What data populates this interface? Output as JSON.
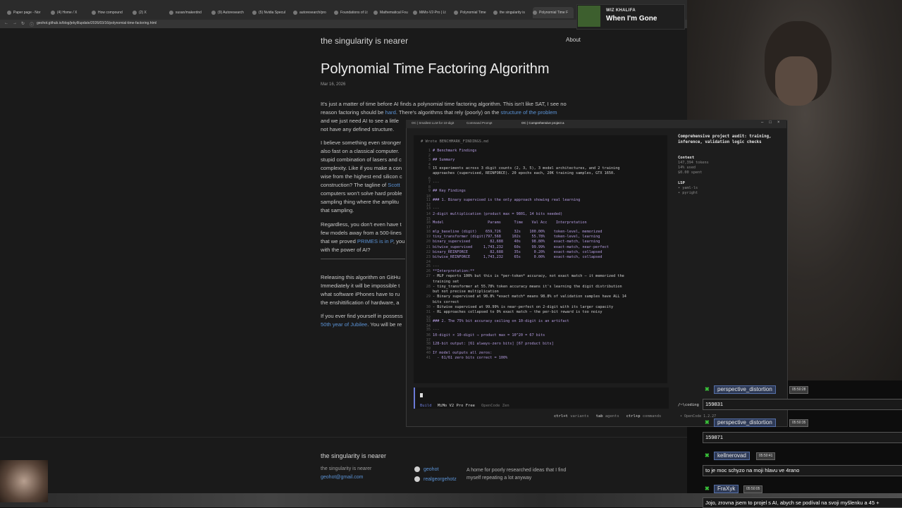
{
  "browser": {
    "tabs": [
      "Paper page - Nor",
      "(4) Home / X",
      "How compound",
      "(2) X",
      "susan/makerdnd",
      "(9) Autoresearch",
      "(5) Nvidia Specul",
      "autoresearch/pro",
      "Foundations of Lt",
      "Mathematical Fou",
      "MiMo-V2-Pro | Lt",
      "Polynomial Time",
      "the singularity is",
      "Polynomial Time F"
    ],
    "url": "geohot.github.io/blog/jekyll/update/2026/03/16/polynomial-time-factoring.html"
  },
  "blog": {
    "site_title": "the singularity is nearer",
    "nav_about": "About",
    "post_title": "Polynomial Time Factoring Algorithm",
    "post_date": "Mar 16, 2026",
    "p1_a": "It's just a matter of time before AI finds a polynomial time factoring algorithm. This isn't like SAT, I see no",
    "p1_b": "reason factoring should be ",
    "p1_link1": "hard",
    "p1_c": ". There's algorithms that rely (poorly) on the ",
    "p1_link2": "structure of the problem",
    "p1_d": "and we just need AI to see a little",
    "p1_e": "not have any defined structure.",
    "p2_a": "I believe something even stronger",
    "p2_b": "also fast on a classical computer.",
    "p2_c": "stupid combination of lasers and c",
    "p2_d": "complexity. Like if you make a con",
    "p2_e": "wise from the highest end silicon c",
    "p2_f": "construction? The tagline of ",
    "p2_link": "Scott",
    "p2_g": "computers won't solve hard proble",
    "p2_h": "sampling thing where the amplitu",
    "p2_i": "that sampling.",
    "p3_a": "Regardless, you don't even have t",
    "p3_b": "few models away from a 500-lines",
    "p3_c": "that we proved ",
    "p3_link": "PRIMES is in P",
    "p3_d": ", you",
    "p3_e": "with the power of AI?",
    "p4_a": "Releasing this algorithm on GitHu",
    "p4_b": "Immediately it will be impossible t",
    "p4_c": "what software iPhones have to ru",
    "p4_d": "the enshittification of hardware, a",
    "p5_a": "If you ever find yourself in possess",
    "p5_link": "50th year of Jubilee",
    "p5_b": ". You will be re",
    "footer_title": "the singularity is nearer",
    "footer_sub": "the singularity is nearer",
    "footer_email": "geohot@gmail.com",
    "footer_github": "geohot",
    "footer_twitter": "realgeorgehotz",
    "footer_desc": "A home for poorly researched ideas that I find myself repeating a lot anyway"
  },
  "now_playing": {
    "artist": "WIZ KHALIFA",
    "song": "When I'm Gone"
  },
  "terminal": {
    "tabs": [
      "OC | Smallest LLM for 10-digit",
      "Command Prompt",
      "OC | Comprehensive project a"
    ],
    "wrote": "# Wrote BENCHMARK_FINDINGS.md",
    "lines": [
      {
        "n": "1",
        "t": "# Benchmark Findings",
        "c": "hdr"
      },
      {
        "n": "2",
        "t": "",
        "c": ""
      },
      {
        "n": "3",
        "t": "## Summary",
        "c": "hdr"
      },
      {
        "n": "4",
        "t": "",
        "c": ""
      },
      {
        "n": "5",
        "t": "15 experiments across 3 digit counts (2, 3, 5), 3 model architectures, and 2 training",
        "c": ""
      },
      {
        "n": "",
        "t": "approaches (supervised, REINFORCE). 20 epochs each, 20K training samples, GTX 1650.",
        "c": ""
      },
      {
        "n": "6",
        "t": "",
        "c": ""
      },
      {
        "n": "7",
        "t": "---",
        "c": "dim"
      },
      {
        "n": "8",
        "t": "",
        "c": ""
      },
      {
        "n": "9",
        "t": "## Key Findings",
        "c": "hdr"
      },
      {
        "n": "10",
        "t": "",
        "c": ""
      },
      {
        "n": "11",
        "t": "### 1. Binary supervised is the only approach showing real learning",
        "c": "hdr"
      },
      {
        "n": "12",
        "t": "",
        "c": ""
      },
      {
        "n": "13",
        "t": "---",
        "c": "dim"
      },
      {
        "n": "14",
        "t": "2-digit multiplication (product max = 9801, 14 bits needed)",
        "c": "hdr"
      },
      {
        "n": "15",
        "t": "",
        "c": ""
      },
      {
        "n": "16",
        "t": "Model                    Params      Time    Val Acc    Interpretation",
        "c": "hdr"
      },
      {
        "n": "17",
        "t": "",
        "c": ""
      },
      {
        "n": "18",
        "t": "mlp_baseline (digit)    659,726      32s    100.00%    token-level, memorized",
        "c": "hdr"
      },
      {
        "n": "19",
        "t": "tiny_transformer (digit)797,568     102s     55.78%    token-level, learning",
        "c": "hdr"
      },
      {
        "n": "20",
        "t": "binary_supervised         82,688     40s     98.80%    exact-match, learning",
        "c": "hdr"
      },
      {
        "n": "21",
        "t": "bitwise_supervised     1,743,232     60s     99.99%    exact-match, near-perfect",
        "c": "hdr"
      },
      {
        "n": "22",
        "t": "binary_REINFORCE          82,688     35s      0.20%    exact-match, collapsed",
        "c": "hdr"
      },
      {
        "n": "23",
        "t": "bitwise_REINFORCE      1,743,232     65s      0.00%    exact-match, collapsed",
        "c": "hdr"
      },
      {
        "n": "24",
        "t": "",
        "c": ""
      },
      {
        "n": "25",
        "t": "---",
        "c": "dim"
      },
      {
        "n": "26",
        "t": "**Interpretation:**",
        "c": "hdr"
      },
      {
        "n": "27",
        "t": "- MLP reports 100% but this is *per-token* accuracy, not exact match — it memorized the",
        "c": ""
      },
      {
        "n": "",
        "t": "training set",
        "c": ""
      },
      {
        "n": "28",
        "t": "- tiny_transformer at 55.78% token accuracy means it's learning the digit distribution",
        "c": ""
      },
      {
        "n": "",
        "t": "but not precise multiplication",
        "c": ""
      },
      {
        "n": "29",
        "t": "- Binary supervised at 98.8% *exact match* means 98.8% of validation samples have ALL 14",
        "c": ""
      },
      {
        "n": "",
        "t": "bits correct",
        "c": ""
      },
      {
        "n": "30",
        "t": "- Bitwise supervised at 99.99% is near-perfect on 2-digit with its larger capacity",
        "c": ""
      },
      {
        "n": "31",
        "t": "- RL approaches collapsed to 0% exact match — the per-bit reward is too noisy",
        "c": ""
      },
      {
        "n": "32",
        "t": "",
        "c": ""
      },
      {
        "n": "33",
        "t": "### 2. The 75% bit accuracy ceiling on 10-digit is an artifact",
        "c": "hdr"
      },
      {
        "n": "34",
        "t": "",
        "c": ""
      },
      {
        "n": "35",
        "t": "---",
        "c": "dim"
      },
      {
        "n": "36",
        "t": "10-digit × 10-digit → product max = 10^20 = 67 bits",
        "c": "hdr"
      },
      {
        "n": "37",
        "t": "",
        "c": ""
      },
      {
        "n": "38",
        "t": "128-bit output: [61 always-zero bits] [67 product bits]",
        "c": "hdr"
      },
      {
        "n": "39",
        "t": "",
        "c": ""
      },
      {
        "n": "40",
        "t": "If model outputs all zeros:",
        "c": "hdr"
      },
      {
        "n": "41",
        "t": "  - 61/61 zero bits correct = 100%",
        "c": "hdr"
      }
    ],
    "status_build": "Build",
    "status_model": "MiMo V2 Pro Free",
    "status_provider": "OpenCode Zen",
    "hint_1_key": "ctrl+t",
    "hint_1": "variants",
    "hint_2_key": "tab",
    "hint_2": "agents",
    "hint_3_key": "ctrl+p",
    "hint_3": "commands",
    "side_title": "Comprehensive project audit: training, inference, validation logic checks",
    "context_head": "Context",
    "context_tokens": "147,394 tokens",
    "context_used": "14% used",
    "context_spent": "$0.00 spent",
    "lsp_head": "LSP",
    "lsp_1": "• yaml-ls",
    "lsp_2": "• pyright",
    "cwd": "/~\\coding",
    "oc_version": "• OpenCode 1.2.27"
  },
  "chat": [
    {
      "user": "perspective_distortion",
      "time": "05:50:28",
      "msg": "159831"
    },
    {
      "user": "perspective_distortion",
      "time": "05:50:35",
      "msg": "159871"
    },
    {
      "user": "kellnerovad",
      "time": "05:50:41",
      "msg": "to je moc schyzo na moji hlavu ve 4rano"
    },
    {
      "user": "FraXyk",
      "time": "05:50:05",
      "msg": "Jojo, zrovna jsem to projel s AI, abych se podíval na svoji myšlenku a 45 +"
    }
  ]
}
